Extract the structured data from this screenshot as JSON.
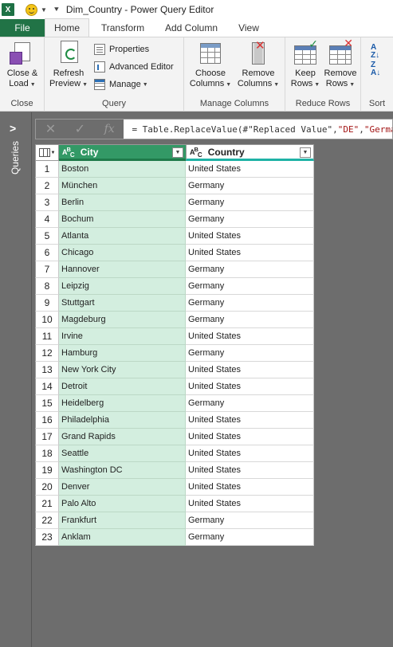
{
  "window": {
    "title": "Dim_Country - Power Query Editor",
    "app_icon": "excel-icon",
    "app_icon_letter": "X"
  },
  "ribbon_tabs": {
    "file": "File",
    "home": "Home",
    "transform": "Transform",
    "add_column": "Add Column",
    "view": "View"
  },
  "ribbon": {
    "close": {
      "group_label": "Close",
      "close_load_line1": "Close &",
      "close_load_line2": "Load"
    },
    "query": {
      "group_label": "Query",
      "refresh_line1": "Refresh",
      "refresh_line2": "Preview",
      "properties": "Properties",
      "advanced_editor": "Advanced Editor",
      "manage": "Manage"
    },
    "manage_columns": {
      "group_label": "Manage Columns",
      "choose_line1": "Choose",
      "choose_line2": "Columns",
      "remove_line1": "Remove",
      "remove_line2": "Columns"
    },
    "reduce_rows": {
      "group_label": "Reduce Rows",
      "keep_line1": "Keep",
      "keep_line2": "Rows",
      "remove_line1": "Remove",
      "remove_line2": "Rows"
    },
    "sort": {
      "group_label": "Sort"
    }
  },
  "query_pane": {
    "label": "Queries",
    "chevron": ">"
  },
  "formula_bar": {
    "cancel": "✕",
    "commit": "✓",
    "fx": "fx",
    "formula_prefix": "= Table.ReplaceValue(#\"Replaced Value\",",
    "formula_str1": "\"DE\"",
    "formula_sep": ",",
    "formula_str2": "\"Germa"
  },
  "table": {
    "columns": [
      {
        "name": "City",
        "type": "text",
        "selected": true
      },
      {
        "name": "Country",
        "type": "text",
        "selected": false
      }
    ],
    "rows": [
      {
        "idx": "1",
        "city": "Boston",
        "country": "United States"
      },
      {
        "idx": "2",
        "city": "München",
        "country": "Germany"
      },
      {
        "idx": "3",
        "city": "Berlin",
        "country": "Germany"
      },
      {
        "idx": "4",
        "city": "Bochum",
        "country": "Germany"
      },
      {
        "idx": "5",
        "city": "Atlanta",
        "country": "United States"
      },
      {
        "idx": "6",
        "city": "Chicago",
        "country": "United States"
      },
      {
        "idx": "7",
        "city": "Hannover",
        "country": "Germany"
      },
      {
        "idx": "8",
        "city": "Leipzig",
        "country": "Germany"
      },
      {
        "idx": "9",
        "city": "Stuttgart",
        "country": "Germany"
      },
      {
        "idx": "10",
        "city": "Magdeburg",
        "country": "Germany"
      },
      {
        "idx": "11",
        "city": "Irvine",
        "country": "United States"
      },
      {
        "idx": "12",
        "city": "Hamburg",
        "country": "Germany"
      },
      {
        "idx": "13",
        "city": "New York City",
        "country": "United States"
      },
      {
        "idx": "14",
        "city": "Detroit",
        "country": "United States"
      },
      {
        "idx": "15",
        "city": "Heidelberg",
        "country": "Germany"
      },
      {
        "idx": "16",
        "city": "Philadelphia",
        "country": "United States"
      },
      {
        "idx": "17",
        "city": "Grand Rapids",
        "country": "United States"
      },
      {
        "idx": "18",
        "city": "Seattle",
        "country": "United States"
      },
      {
        "idx": "19",
        "city": "Washington DC",
        "country": "United States"
      },
      {
        "idx": "20",
        "city": "Denver",
        "country": "United States"
      },
      {
        "idx": "21",
        "city": "Palo Alto",
        "country": "United States"
      },
      {
        "idx": "22",
        "city": "Frankfurt",
        "country": "Germany"
      },
      {
        "idx": "23",
        "city": "Anklam",
        "country": "Germany"
      }
    ]
  },
  "colors": {
    "file_tab": "#217346",
    "selected_column_header": "#339966",
    "selected_column_cells": "#d3eedf",
    "background": "#6d6d6d"
  }
}
